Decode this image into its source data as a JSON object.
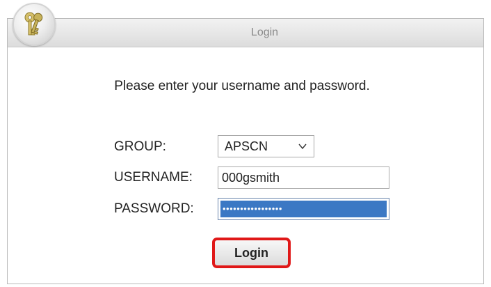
{
  "header": {
    "title": "Login",
    "icon": "keys-icon"
  },
  "form": {
    "prompt": "Please enter your username and password.",
    "group_label": "GROUP:",
    "group_value": "APSCN",
    "username_label": "USERNAME:",
    "username_value": "000gsmith",
    "password_label": "PASSWORD:",
    "password_masked": "•••••••••••••••••"
  },
  "actions": {
    "login_label": "Login"
  },
  "colors": {
    "accent_highlight": "#e01818",
    "password_selection": "#3b78c4",
    "titlebar": "#dcdcdc"
  }
}
